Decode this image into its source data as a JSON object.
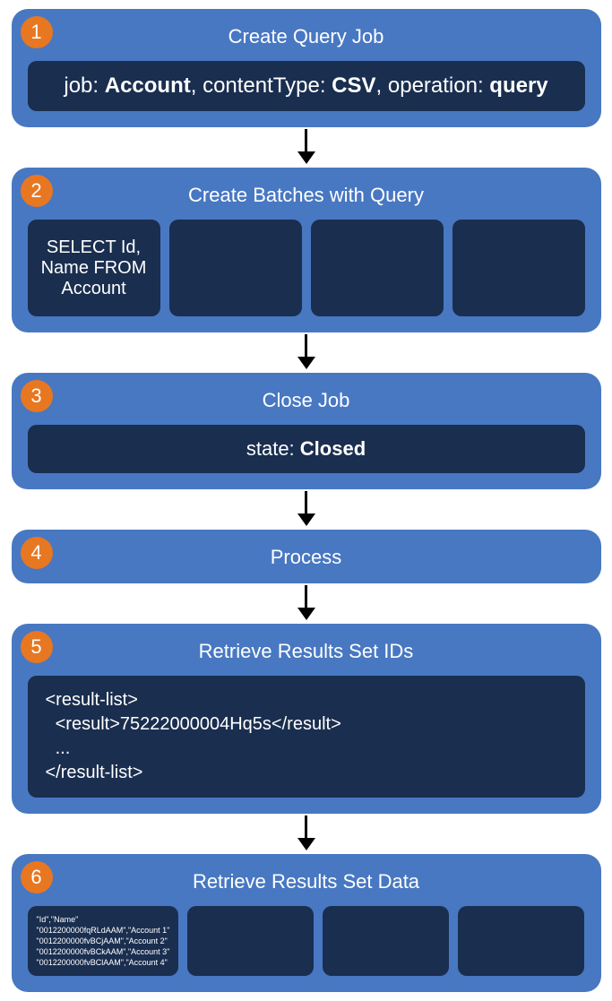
{
  "steps": [
    {
      "num": "1",
      "title": "Create Query Job",
      "content_html": "job: <b>Account</b>, contentType: <b>CSV</b>, operation: <b>query</b>",
      "content_plain": "job: Account, contentType: CSV, operation: query"
    },
    {
      "num": "2",
      "title": "Create Batches with Query",
      "cells": [
        "SELECT Id,\nName FROM\nAccount",
        "",
        "",
        ""
      ]
    },
    {
      "num": "3",
      "title": "Close Job",
      "content_html": "state: <b>Closed</b>",
      "content_plain": "state: Closed"
    },
    {
      "num": "4",
      "title": "Process"
    },
    {
      "num": "5",
      "title": "Retrieve Results Set IDs",
      "code": "<result-list>\n  <result>75222000004Hq5s</result>\n  ...\n</result-list>"
    },
    {
      "num": "6",
      "title": "Retrieve Results Set Data",
      "cells_small": [
        "\"Id\",\"Name\"\n\"0012200000fqRLdAAM\",\"Account 1\"\n\"0012200000fvBCjAAM\",\"Account 2\"\n\"0012200000fvBCkAAM\",\"Account 3\"\n\"0012200000fvBClAAM\",\"Account 4\"",
        "",
        "",
        ""
      ]
    }
  ]
}
